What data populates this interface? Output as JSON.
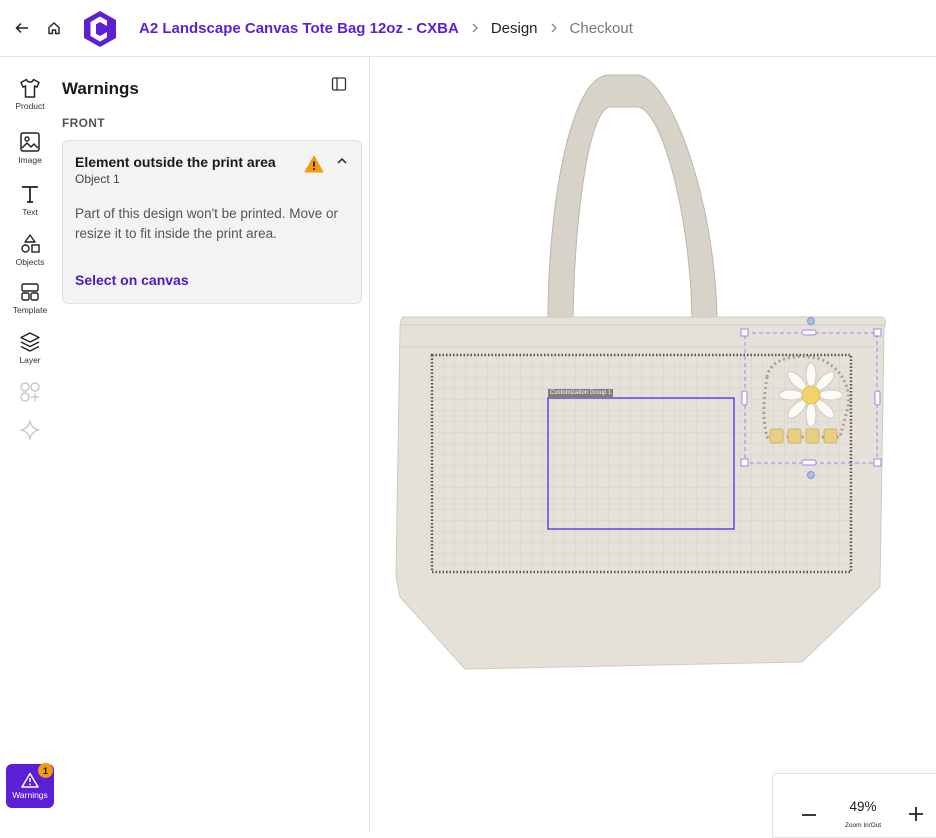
{
  "header": {
    "back_icon": "arrow-left-icon",
    "home_icon": "home-icon",
    "logo_icon": "brand-logo",
    "breadcrumb": {
      "product": "A2 Landscape Canvas Tote Bag 12oz - CXBA",
      "design": "Design",
      "checkout": "Checkout"
    },
    "accent_color": "#5b1fd6"
  },
  "toolbar": {
    "items": [
      {
        "label": "Product",
        "icon": "tshirt-icon"
      },
      {
        "label": "Image",
        "icon": "image-icon"
      },
      {
        "label": "Text",
        "icon": "text-icon"
      },
      {
        "label": "Objects",
        "icon": "shapes-icon"
      },
      {
        "label": "Template",
        "icon": "template-icon"
      },
      {
        "label": "Layer",
        "icon": "layers-icon"
      }
    ],
    "disabled_icons": [
      "add-group-icon",
      "sparkle-icon"
    ],
    "warnings": {
      "label": "Warnings",
      "count": "1",
      "icon": "warning-icon"
    }
  },
  "panel": {
    "title": "Warnings",
    "section": "FRONT",
    "card": {
      "title": "Element outside the print area",
      "subtitle": "Object 1",
      "body": "Part of this design won't be printed. Move or resize it to fit inside the print area.",
      "link": "Select on canvas",
      "warn_color": "#f59a0b"
    }
  },
  "canvas": {
    "group_label": "Customization Group 1"
  },
  "zoom": {
    "value": "49%",
    "caption": "Zoom In/Out"
  }
}
